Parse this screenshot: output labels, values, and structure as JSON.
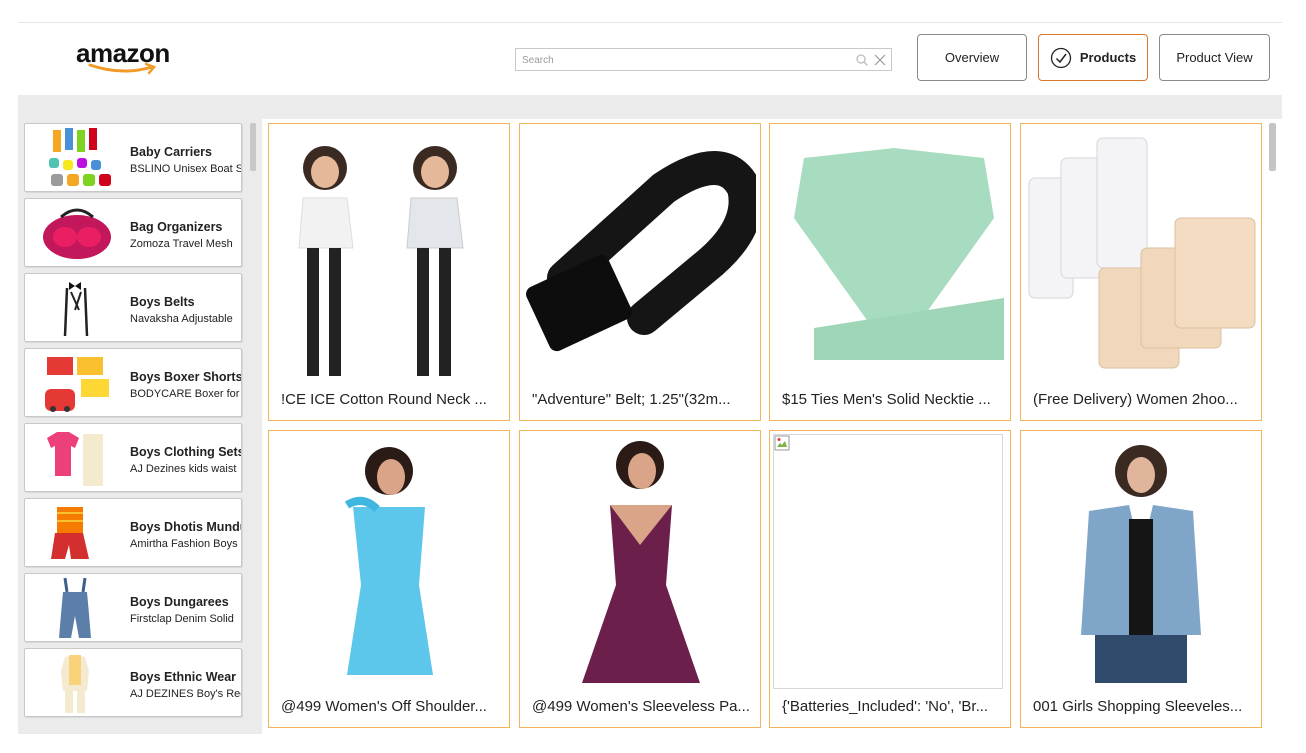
{
  "header": {
    "logo_text": "amazon",
    "search": {
      "placeholder": "Search",
      "value": ""
    },
    "nav": [
      {
        "label": "Overview",
        "active": false
      },
      {
        "label": "Products",
        "active": true
      },
      {
        "label": "Product View",
        "active": false
      }
    ]
  },
  "sidebar": {
    "items": [
      {
        "title": "Baby Carriers",
        "subtitle": "BSLINO Unisex Boat Sox"
      },
      {
        "title": "Bag Organizers",
        "subtitle": "Zomoza Travel Mesh"
      },
      {
        "title": "Boys Belts",
        "subtitle": "Navaksha Adjustable"
      },
      {
        "title": "Boys Boxer Shorts",
        "subtitle": "BODYCARE Boxer for"
      },
      {
        "title": "Boys Clothing Sets",
        "subtitle": "AJ Dezines kids waist"
      },
      {
        "title": "Boys Dhotis Mundu",
        "subtitle": "Amirtha Fashion Boys"
      },
      {
        "title": "Boys Dungarees",
        "subtitle": "Firstclap Denim Solid"
      },
      {
        "title": "Boys Ethnic Wear",
        "subtitle": "AJ DEZINES Boy's Reg"
      }
    ]
  },
  "products": [
    {
      "caption": "!CE ICE Cotton Round Neck ..."
    },
    {
      "caption": "\"Adventure\" Belt; 1.25\"(32m..."
    },
    {
      "caption": "$15 Ties Men's Solid Necktie ..."
    },
    {
      "caption": "(Free Delivery) Women 2hoo..."
    },
    {
      "caption": "@499 Women's Off Shoulder..."
    },
    {
      "caption": "@499 Women's Sleeveless Pa..."
    },
    {
      "caption": "{'Batteries_Included': 'No', 'Br..."
    },
    {
      "caption": "001 Girls Shopping Sleeveles..."
    }
  ],
  "colors": {
    "accent": "#d9772b",
    "card_border": "#f2b35a",
    "logo_smile": "#f09a28"
  },
  "icons": {
    "search": "search-icon",
    "clear": "close-icon",
    "active": "check-circle-icon"
  }
}
